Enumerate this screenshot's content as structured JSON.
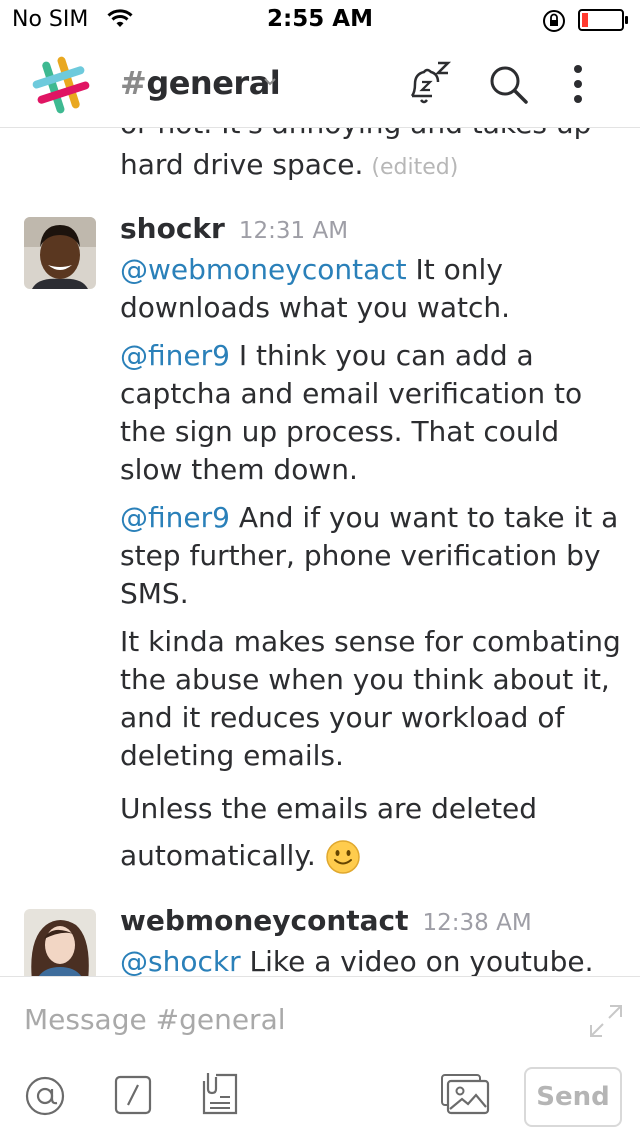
{
  "status_bar": {
    "carrier": "No SIM",
    "time": "2:55 AM"
  },
  "header": {
    "channel_hash": "#",
    "channel_name": "general"
  },
  "messages": {
    "prev_tail_line": "or not. It's annoying and takes up",
    "prev_line": "hard drive space.",
    "prev_edited": "(edited)",
    "group1": {
      "author": "shockr",
      "time": "12:31 AM",
      "m1_mention": "@webmoneycontact",
      "m1_text": " It only downloads what you watch.",
      "m2_mention": "@finer9",
      "m2_text": " I think you can add a captcha and email verification to the sign up process. That could slow them down.",
      "m3_mention": "@finer9",
      "m3_text": " And if you want to take it a step further, phone verification by SMS.",
      "m4_text": "It kinda makes sense for combating the abuse when you think about it, and it reduces your workload of deleting emails.",
      "m5_text": "Unless the emails are deleted automatically.",
      "m5_emoji": "🙂"
    },
    "group2": {
      "author": "webmoneycontact",
      "time": "12:38 AM",
      "m1_mention": "@shockr",
      "m1_text": " Like a video on youtube."
    }
  },
  "composer": {
    "placeholder": "Message #general",
    "send_label": "Send"
  },
  "icons": {
    "wifi": "wifi-icon",
    "lock": "rotation-lock-icon",
    "battery": "battery-icon",
    "logo": "slack-logo-icon",
    "chevron": "chevron-down-icon",
    "snooze": "snooze-bell-icon",
    "search": "search-icon",
    "more": "more-vertical-icon",
    "expand": "expand-icon",
    "at": "at-icon",
    "slash": "slash-command-icon",
    "file": "file-icon",
    "photo": "photo-icon"
  },
  "colors": {
    "mention": "#2a80b9",
    "battery_low": "#ff3b30",
    "text": "#2c2d30",
    "muted": "#9e9ea6"
  }
}
